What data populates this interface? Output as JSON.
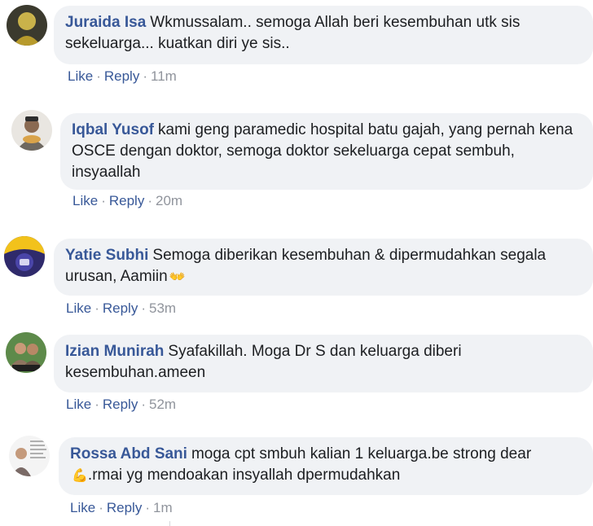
{
  "comments": [
    {
      "author": "Juraida Isa",
      "text": "Wkmussalam.. semoga Allah beri kesembuhan utk sis sekeluarga... kuatkan diri ye sis..",
      "like_label": "Like",
      "reply_label": "Reply",
      "time": "11m",
      "avatar_icon": "profile-photo"
    },
    {
      "author": "Iqbal Yusof",
      "text": "kami geng paramedic hospital batu gajah, yang pernah kena OSCE dengan doktor, semoga doktor sekeluarga cepat sembuh, insyaallah",
      "like_label": "Like",
      "reply_label": "Reply",
      "time": "20m",
      "avatar_icon": "profile-photo"
    },
    {
      "author": "Yatie Subhi",
      "text": "Semoga diberikan kesembuhan & dipermudahkan segala urusan, Aamiin",
      "emoji": "👐",
      "like_label": "Like",
      "reply_label": "Reply",
      "time": "53m",
      "avatar_icon": "profile-photo"
    },
    {
      "author": "Izian Munirah",
      "text": "Syafakillah. Moga Dr S dan keluarga diberi kesembuhan.ameen",
      "like_label": "Like",
      "reply_label": "Reply",
      "time": "52m",
      "avatar_icon": "profile-photo"
    },
    {
      "author": "Rossa Abd Sani",
      "text": "moga cpt smbuh kalian 1 keluarga.be strong dear",
      "emoji": "💪",
      "text_after_emoji": ".rmai yg mendoakan insyallah dpermudahkan",
      "like_label": "Like",
      "reply_label": "Reply",
      "time": "1m",
      "avatar_icon": "profile-photo"
    }
  ],
  "colors": {
    "author": "#385898",
    "bubble": "#f0f2f5",
    "meta": "#90949c",
    "text": "#1c1e21"
  }
}
